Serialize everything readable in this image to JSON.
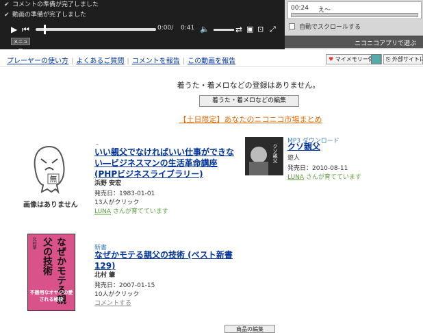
{
  "player": {
    "status_lines": [
      "コメントの準備が完了しました",
      "動画の準備が完了しました"
    ],
    "time_current": "0:00/",
    "time_total": "0:41",
    "menu_label": "メニュー"
  },
  "comment_panel": {
    "row_time": "00:24",
    "row_text": "え～",
    "auto_scroll_label": "自動でスクロールする",
    "app_link_label": "ニコニコアプリで遊ぶ"
  },
  "info_bar": {
    "links": [
      "プレーヤーの使い方",
      "よくあるご質問",
      "コメントを報告",
      "この動画を報告"
    ],
    "mymemory_label": "マイメモリー保存",
    "external_label": "外部サイトに"
  },
  "chakuuta": {
    "message": "着うた・着メロなどの登録はありません。",
    "edit_button": "着うた・着メロなどの編集"
  },
  "market": {
    "headline": "【土日限定】あなたのニコニコ市場まとめ",
    "no_image_label": "画像はありません",
    "no_image_face_label": "無",
    "items": [
      {
        "category": "–",
        "title": "いい親父でなければいい仕事ができない―ビジネスマンの生活革命講座 (PHPビジネスライブラリー)",
        "author": "浜野 安宏",
        "release": "発売日：1983-01-01",
        "clicks": "13人がクリック",
        "nurture_user": "LUNA",
        "nurture_text": " さんが育てています"
      },
      {
        "category": "MP3 ダウンロード",
        "title": "クソ親父",
        "author": "遊人",
        "release": "発売日：2010-08-11",
        "nurture_user": "LUNA",
        "nurture_text": " さんが育てています"
      },
      {
        "category": "新書",
        "title": "なぜかモテる親父の技術 (ベスト新書 129)",
        "author": "北村 肇",
        "release": "発売日：2007-01-15",
        "clicks": "10人がクリック",
        "comment_link": "コメントする"
      }
    ],
    "book_cover": {
      "author": "北村肇",
      "title": "なぜかモテる親父の技術",
      "tagline": "不器用なオヤジの愛される秘訣"
    },
    "mp3_cover_text": "クソ親父",
    "bottom_button": "商品の編集"
  }
}
